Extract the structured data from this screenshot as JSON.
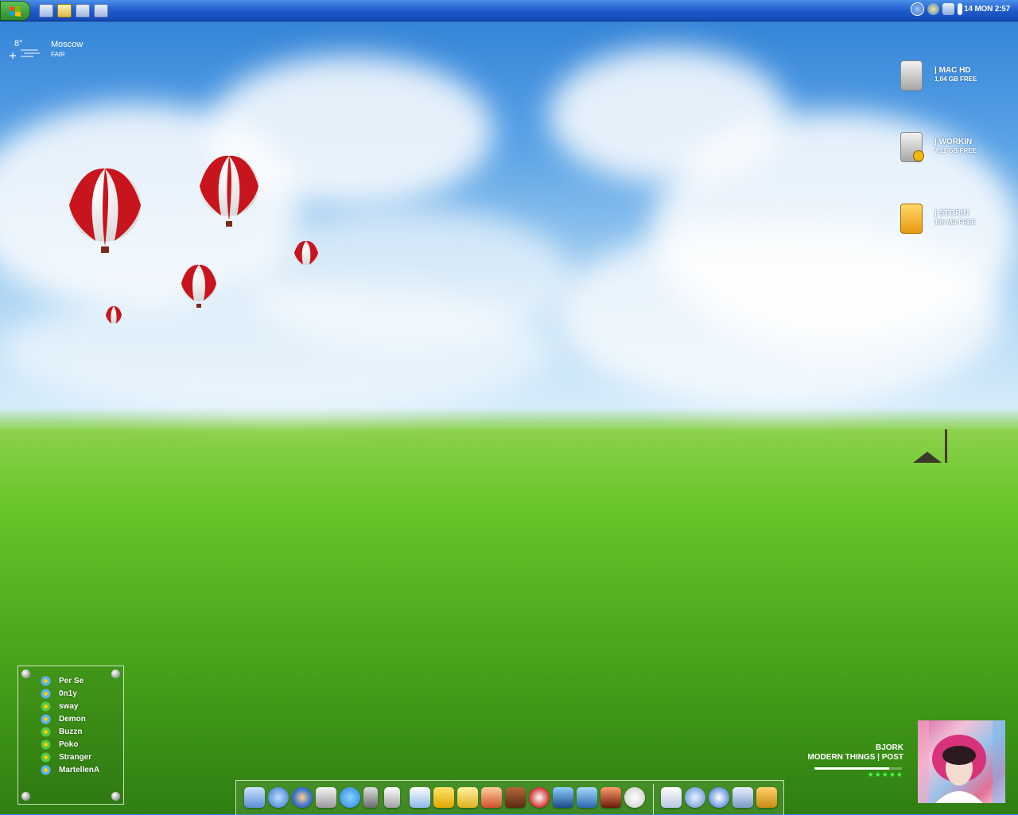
{
  "taskbar": {
    "start_icon": "windows-flag-icon",
    "quick_launch": [
      "computer-icon",
      "documents-icon",
      "explorer-icon",
      "desktop-icon"
    ],
    "tray_icons": [
      "back-arrow-icon",
      "network-icon",
      "display-icon",
      "volume-icon"
    ],
    "clock": "14 MON 2:57"
  },
  "weather": {
    "temperature": "8°",
    "city": "Moscow",
    "condition": "FAIR"
  },
  "drives": [
    {
      "name": "| MAC HD",
      "free": "1,04 GB FREE",
      "icon": "hard-drive-icon"
    },
    {
      "name": "| WORKIN",
      "free": "7,11 GB FREE",
      "icon": "hard-drive-icon"
    },
    {
      "name": "| STORIN",
      "free": "196 MB FREE",
      "icon": "usb-drive-icon"
    }
  ],
  "contacts": [
    {
      "name": "Per Se",
      "status": "online"
    },
    {
      "name": "0n1y",
      "status": "online"
    },
    {
      "name": "sway",
      "status": "online"
    },
    {
      "name": "Demon",
      "status": "online"
    },
    {
      "name": "Buzzn",
      "status": "online"
    },
    {
      "name": "Poko",
      "status": "online"
    },
    {
      "name": "Stranger",
      "status": "online"
    },
    {
      "name": "MartellenA",
      "status": "online"
    }
  ],
  "dock": {
    "apps": [
      "finder-icon",
      "network-icon",
      "browser-icon",
      "photo-icon",
      "chat-icon",
      "server-icon",
      "tools-icon",
      "mail-icon",
      "skype-icon",
      "notes-icon",
      "pen-icon",
      "book-icon",
      "media-player-icon",
      "movie-icon",
      "phone-icon",
      "photo-editor-icon",
      "ghost-icon"
    ],
    "utilities": [
      "text-edit-icon",
      "search-icon",
      "update-icon",
      "archive-icon",
      "box-icon"
    ]
  },
  "now_playing": {
    "artist": "BJORK",
    "track": "MODERN THINGS | POST",
    "rating": "★★★★★",
    "progress": 0.85
  },
  "colors": {
    "taskbar": "#1f5ccc",
    "start": "#2e8b2b",
    "grass": "#49a51a",
    "sky": "#5aa3e6"
  }
}
